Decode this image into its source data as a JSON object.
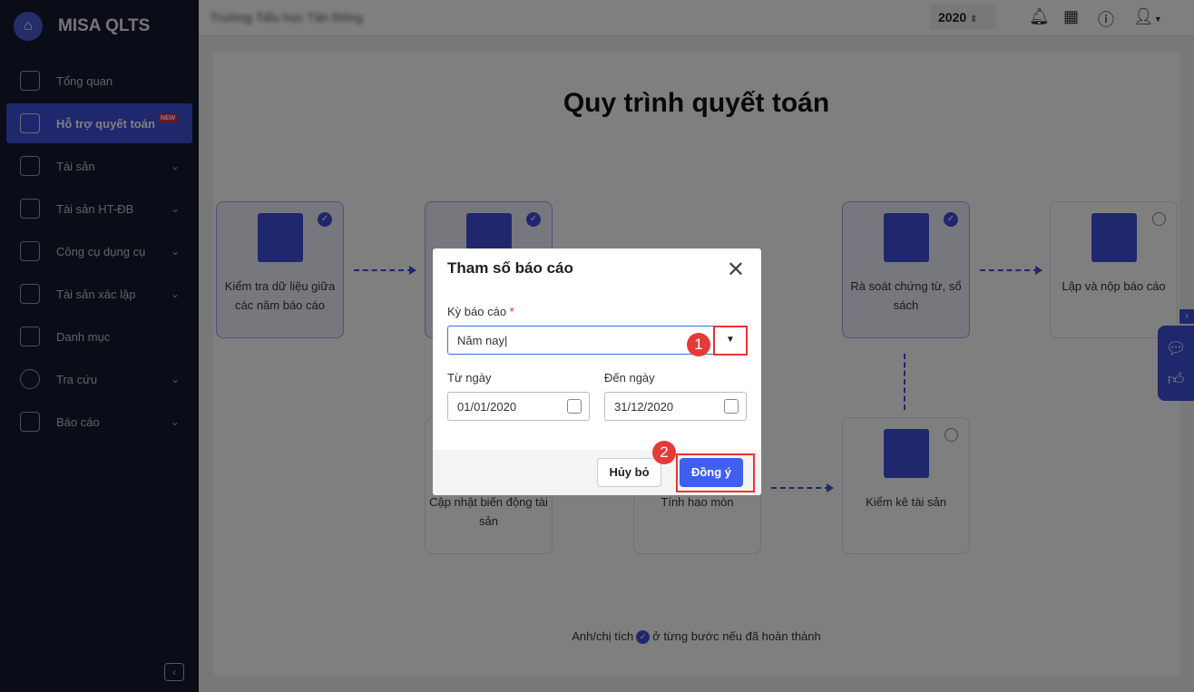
{
  "sidebar": {
    "app_name": "MISA QLTS",
    "items": [
      {
        "label": "Tổng quan",
        "icon": "monitor-chart-icon"
      },
      {
        "label": "Hỗ trợ quyết toán",
        "icon": "clipboard-check-icon",
        "badge": "NEW",
        "active": true
      },
      {
        "label": "Tài sản",
        "icon": "car-house-icon",
        "expand": true
      },
      {
        "label": "Tài sản HT-ĐB",
        "icon": "road-icon",
        "expand": true
      },
      {
        "label": "Công cụ dụng cụ",
        "icon": "paint-roller-icon",
        "expand": true
      },
      {
        "label": "Tài sản xác lập",
        "icon": "car-house-icon",
        "expand": true
      },
      {
        "label": "Danh mục",
        "icon": "list-icon"
      },
      {
        "label": "Tra cứu",
        "icon": "search-icon",
        "expand": true
      },
      {
        "label": "Báo cáo",
        "icon": "bar-chart-icon",
        "expand": true
      }
    ]
  },
  "header": {
    "org_name": "Trường Tiểu học Tân Đông",
    "year": "2020"
  },
  "main": {
    "title": "Quy trình quyết toán",
    "steps": [
      {
        "label": "Kiểm tra dữ liệu giữa các năm báo cáo",
        "done": true
      },
      {
        "label": "",
        "done": true
      },
      {
        "label": "Rà soát chứng từ, sổ sách",
        "done": true
      },
      {
        "label": "Lập và nộp báo cáo",
        "done": false
      },
      {
        "label": "Cập nhật biến động tài sản",
        "done": false
      },
      {
        "label": "Tính hao mòn",
        "done": false
      },
      {
        "label": "Kiểm kê tài sản",
        "done": false
      }
    ],
    "hint_before": "Anh/chị tích",
    "hint_after": "ở từng bước nếu đã hoàn thành"
  },
  "dialog": {
    "title": "Tham số báo cáo",
    "period_label": "Kỳ báo cáo",
    "required_mark": "*",
    "period_value": "Năm nay",
    "from_label": "Từ ngày",
    "from_value": "01/01/2020",
    "to_label": "Đến ngày",
    "to_value": "31/12/2020",
    "cancel": "Hủy bỏ",
    "ok": "Đồng ý",
    "marker1": "1",
    "marker2": "2"
  }
}
